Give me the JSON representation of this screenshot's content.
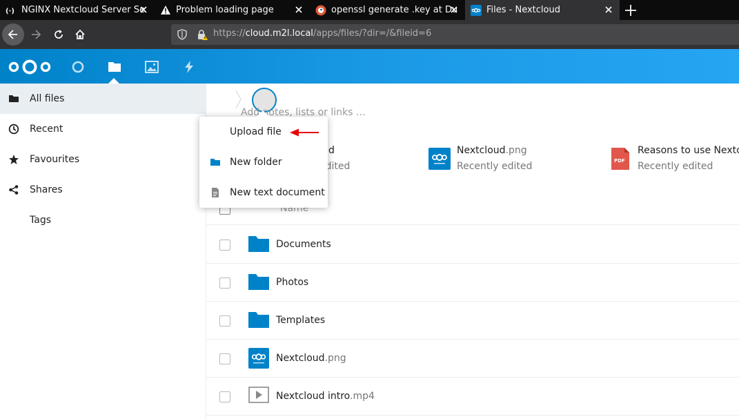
{
  "browser": {
    "tabs": [
      {
        "title": "NGINX Nextcloud Server Se",
        "icon": "nginx-icon",
        "active": false
      },
      {
        "title": "Problem loading page",
        "icon": "warning-icon",
        "active": false
      },
      {
        "title": "openssl generate .key at Du",
        "icon": "duckduckgo-icon",
        "active": false
      },
      {
        "title": "Files - Nextcloud",
        "icon": "nextcloud-icon",
        "active": true
      }
    ],
    "url": {
      "scheme": "https://",
      "host": "cloud.m2l.local",
      "path": "/apps/files/?dir=/&fileid=6"
    }
  },
  "header": {
    "apps": [
      {
        "name": "dashboard",
        "icon": "circle-icon"
      },
      {
        "name": "files",
        "icon": "folder-icon",
        "active": true
      },
      {
        "name": "photos",
        "icon": "image-icon"
      },
      {
        "name": "activity",
        "icon": "lightning-icon"
      }
    ],
    "accent_color": "#0082c9"
  },
  "sidebar": {
    "items": [
      {
        "label": "All files",
        "icon": "folder-icon",
        "active": true
      },
      {
        "label": "Recent",
        "icon": "clock-icon"
      },
      {
        "label": "Favourites",
        "icon": "star-icon"
      },
      {
        "label": "Shares",
        "icon": "share-icon"
      },
      {
        "label": "Tags",
        "icon": "tag-icon"
      }
    ]
  },
  "main": {
    "rich_workspace_hint": "Add notes, lists or links …",
    "recent": [
      {
        "partial_name": "d",
        "partial_sub": "edited"
      },
      {
        "name": "Nextcloud",
        "ext": ".png",
        "sub": "Recently edited",
        "icon": "nextcloud-thumb-icon"
      },
      {
        "name": "Reasons to use Nextc",
        "ext": "",
        "sub": "Recently edited",
        "icon": "pdf-icon"
      }
    ],
    "list_header": {
      "name": "Name"
    },
    "files": [
      {
        "name": "Documents",
        "ext": "",
        "icon": "folder-icon"
      },
      {
        "name": "Photos",
        "ext": "",
        "icon": "folder-icon"
      },
      {
        "name": "Templates",
        "ext": "",
        "icon": "folder-icon"
      },
      {
        "name": "Nextcloud",
        "ext": ".png",
        "icon": "nextcloud-thumb-icon"
      },
      {
        "name": "Nextcloud intro",
        "ext": ".mp4",
        "icon": "video-icon"
      }
    ]
  },
  "new_menu": {
    "items": [
      {
        "label": "Upload file",
        "icon": "upload-icon"
      },
      {
        "label": "New folder",
        "icon": "folder-icon"
      },
      {
        "label": "New text document",
        "icon": "text-document-icon"
      }
    ],
    "annotation_color": "#e60000"
  },
  "pdf_badge": "PDF"
}
